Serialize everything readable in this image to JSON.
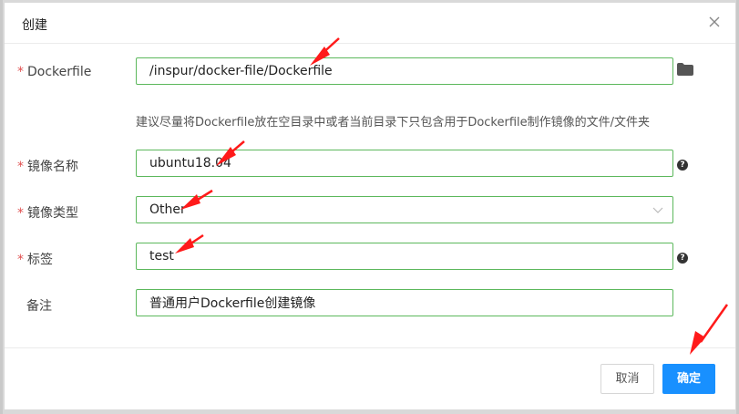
{
  "dialog": {
    "title": "创建",
    "close_icon": "close-icon"
  },
  "form": {
    "dockerfile": {
      "label": "Dockerfile",
      "required": "*",
      "value": "/inspur/docker-file/Dockerfile",
      "icon": "folder-icon",
      "hint": "建议尽量将Dockerfile放在空目录中或者当前目录下只包含用于Dockerfile制作镜像的文件/文件夹"
    },
    "image_name": {
      "label": "镜像名称",
      "required": "*",
      "value": "ubuntu18.04",
      "help": "?"
    },
    "image_type": {
      "label": "镜像类型",
      "required": "*",
      "value": "Other"
    },
    "tag": {
      "label": "标签",
      "required": "*",
      "value": "test",
      "help": "?"
    },
    "remark": {
      "label": "备注",
      "value": "普通用户Dockerfile创建镜像"
    }
  },
  "footer": {
    "cancel_label": "取消",
    "ok_label": "确定"
  },
  "colors": {
    "accent": "#1890ff",
    "input_border": "#5cb85c",
    "required": "#e04f4f",
    "annotation_arrow": "#ff1a1a"
  }
}
